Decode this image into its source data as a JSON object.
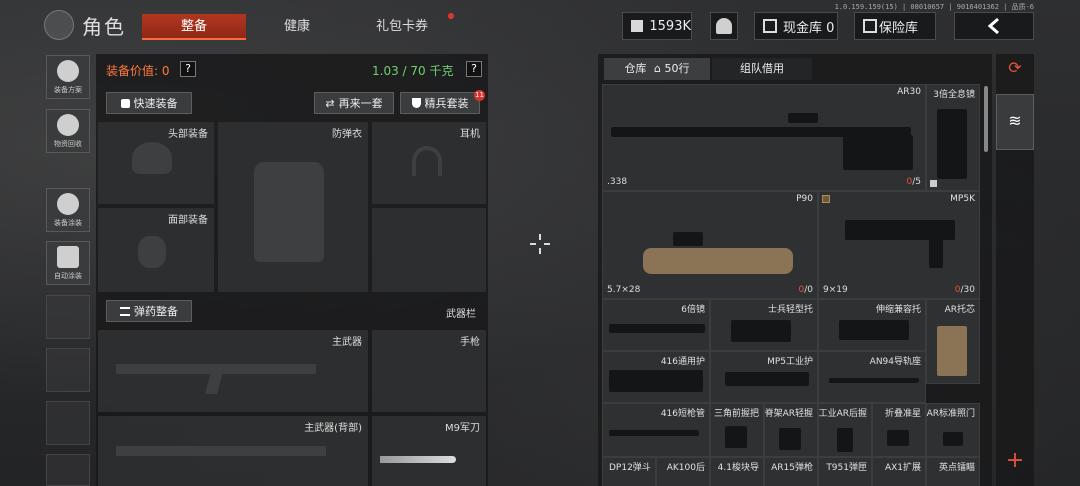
{
  "version_text": "1.0.159.159(15) | 08010657 | 9016401362 | 品质-6",
  "header": {
    "title": "角色",
    "tabs": [
      {
        "label": "整备",
        "active": true
      },
      {
        "label": "健康",
        "active": false
      },
      {
        "label": "礼包卡券",
        "active": false
      }
    ],
    "currency": "1593K",
    "cash_vault": "现金库 0",
    "safe_box": "保险库"
  },
  "sidebar": {
    "items": [
      {
        "label": "装备方案",
        "icon": "helmet-plan-icon"
      },
      {
        "label": "物资回收",
        "icon": "recycle-icon"
      },
      {
        "label": "装备涂装",
        "icon": "paint-icon"
      },
      {
        "label": "自动涂装",
        "icon": "auto-paint-icon"
      }
    ]
  },
  "equip": {
    "value_label": "装备价值: 0",
    "weight": "1.03 / 70 千克",
    "quick_equip": "快速装备",
    "again": "再来一套",
    "elite_kit": "精兵套装",
    "elite_badge": "11",
    "slots": {
      "head": "头部装备",
      "armor": "防弹衣",
      "earphone": "耳机",
      "face": "面部装备"
    },
    "ammo_button": "弹药整备",
    "weapon_bar": "武器栏",
    "primary": "主武器",
    "pistol": "手枪",
    "primary_back": "主武器(背部)",
    "knife": "M9军刀"
  },
  "storage": {
    "tab_warehouse": "仓库",
    "rows": "50行",
    "tab_team": "组队借用",
    "items": [
      {
        "name": "AR30",
        "caliber": ".338",
        "ammo_cur": "0",
        "ammo_max": "/5"
      },
      {
        "name": "3倍全息镜"
      },
      {
        "name": "P90",
        "caliber": "5.7×28",
        "ammo_cur": "0",
        "ammo_max": "/0"
      },
      {
        "name": "MP5K",
        "caliber": "9×19",
        "ammo_cur": "0",
        "ammo_max": "/30"
      },
      {
        "name": "6倍镜"
      },
      {
        "name": "士兵轻型托"
      },
      {
        "name": "伸缩兼容托"
      },
      {
        "name": "AR托芯"
      },
      {
        "name": "416通用护"
      },
      {
        "name": "MP5工业护"
      },
      {
        "name": "AN94导轨座"
      },
      {
        "name": "416短枪管"
      },
      {
        "name": "三角前握把"
      },
      {
        "name": "脊架AR轻握"
      },
      {
        "name": "工业AR后握"
      },
      {
        "name": "折叠准星"
      },
      {
        "name": "AR标准照门"
      },
      {
        "name": "DP12弹斗"
      },
      {
        "name": "AK100后"
      },
      {
        "name": "4.1梭块导"
      },
      {
        "name": "AR15弹枪"
      },
      {
        "name": "T951弹匣"
      },
      {
        "name": "AX1扩展"
      },
      {
        "name": "英点镭瞄"
      }
    ]
  },
  "colors": {
    "accent_red": "#b3361f",
    "warn_red": "#e4533f",
    "weight_green": "#6fd16f",
    "value_orange": "#ff7a3a"
  }
}
